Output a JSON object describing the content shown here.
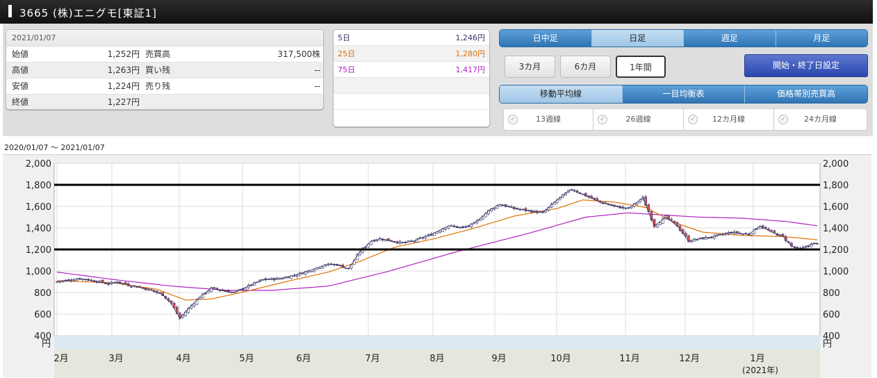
{
  "header": {
    "title": "3665 (株)エニグモ[東証1]"
  },
  "prices": {
    "date": "2021/01/07",
    "rows": [
      {
        "label": "始値",
        "value": "1,252円",
        "label2": "売買高",
        "value2": "317,500株"
      },
      {
        "label": "高値",
        "value": "1,263円",
        "label2": "買い残",
        "value2": "--"
      },
      {
        "label": "安値",
        "value": "1,224円",
        "label2": "売り残",
        "value2": "--"
      },
      {
        "label": "終値",
        "value": "1,227円",
        "label2": "",
        "value2": ""
      }
    ]
  },
  "moving_averages": [
    {
      "label": "5日",
      "value": "1,246円",
      "color": "#333366"
    },
    {
      "label": "25日",
      "value": "1,280円",
      "color": "#e07000"
    },
    {
      "label": "75日",
      "value": "1,417円",
      "color": "#b020c0"
    }
  ],
  "period_tabs": [
    "日中足",
    "日足",
    "週足",
    "月足"
  ],
  "period_active": 1,
  "range_buttons": [
    "3カ月",
    "6カ月",
    "1年間"
  ],
  "range_active": 2,
  "date_setting_button": "開始・終了日設定",
  "indicator_tabs": [
    "移動平均線",
    "一目均衡表",
    "価格帯別売買高"
  ],
  "indicator_active": 0,
  "ma_toggles": [
    "13週線",
    "26週線",
    "12カ月線",
    "24カ月線"
  ],
  "date_range": "2020/01/07 ～ 2021/01/07",
  "chart_data": {
    "type": "candlestick",
    "y_ticks": [
      "2,000",
      "1,800",
      "1,600",
      "1,400",
      "1,200",
      "1,000",
      "800",
      "600",
      "400"
    ],
    "ylim": [
      400,
      2000
    ],
    "y_unit": "円",
    "x_months": [
      "2月",
      "3月",
      "4月",
      "5月",
      "6月",
      "7月",
      "8月",
      "9月",
      "10月",
      "11月",
      "12月",
      "1月"
    ],
    "x_year_note": "(2021年)",
    "reference_lines": [
      1800,
      1200
    ],
    "price_path": [
      [
        0,
        900
      ],
      [
        8,
        930
      ],
      [
        14,
        905
      ],
      [
        18,
        880
      ],
      [
        21,
        900
      ],
      [
        25,
        870
      ],
      [
        29,
        850
      ],
      [
        33,
        820
      ],
      [
        37,
        780
      ],
      [
        40,
        700
      ],
      [
        43,
        560
      ],
      [
        46,
        650
      ],
      [
        50,
        760
      ],
      [
        54,
        840
      ],
      [
        58,
        820
      ],
      [
        62,
        800
      ],
      [
        67,
        860
      ],
      [
        72,
        920
      ],
      [
        78,
        930
      ],
      [
        83,
        960
      ],
      [
        88,
        1000
      ],
      [
        94,
        1060
      ],
      [
        98,
        1060
      ],
      [
        102,
        1020
      ],
      [
        106,
        1180
      ],
      [
        110,
        1280
      ],
      [
        113,
        1300
      ],
      [
        117,
        1280
      ],
      [
        121,
        1260
      ],
      [
        125,
        1280
      ],
      [
        131,
        1340
      ],
      [
        137,
        1420
      ],
      [
        142,
        1400
      ],
      [
        146,
        1440
      ],
      [
        151,
        1560
      ],
      [
        155,
        1620
      ],
      [
        160,
        1580
      ],
      [
        165,
        1560
      ],
      [
        170,
        1540
      ],
      [
        175,
        1660
      ],
      [
        180,
        1760
      ],
      [
        185,
        1700
      ],
      [
        190,
        1640
      ],
      [
        195,
        1600
      ],
      [
        200,
        1580
      ],
      [
        205,
        1680
      ],
      [
        209,
        1420
      ],
      [
        213,
        1500
      ],
      [
        217,
        1420
      ],
      [
        221,
        1280
      ],
      [
        225,
        1300
      ],
      [
        230,
        1320
      ],
      [
        236,
        1360
      ],
      [
        242,
        1340
      ],
      [
        246,
        1420
      ],
      [
        250,
        1360
      ],
      [
        254,
        1320
      ],
      [
        257,
        1230
      ],
      [
        260,
        1200
      ],
      [
        263,
        1240
      ],
      [
        266,
        1260
      ]
    ],
    "ma25_path": [
      [
        0,
        910
      ],
      [
        20,
        890
      ],
      [
        35,
        830
      ],
      [
        45,
        730
      ],
      [
        54,
        740
      ],
      [
        66,
        810
      ],
      [
        80,
        900
      ],
      [
        95,
        990
      ],
      [
        106,
        1090
      ],
      [
        118,
        1220
      ],
      [
        132,
        1300
      ],
      [
        145,
        1390
      ],
      [
        160,
        1510
      ],
      [
        175,
        1580
      ],
      [
        184,
        1660
      ],
      [
        195,
        1640
      ],
      [
        206,
        1590
      ],
      [
        216,
        1450
      ],
      [
        226,
        1360
      ],
      [
        240,
        1330
      ],
      [
        254,
        1320
      ],
      [
        266,
        1290
      ]
    ],
    "ma75_path": [
      [
        0,
        990
      ],
      [
        20,
        920
      ],
      [
        40,
        860
      ],
      [
        60,
        820
      ],
      [
        75,
        820
      ],
      [
        95,
        860
      ],
      [
        115,
        990
      ],
      [
        140,
        1180
      ],
      [
        165,
        1350
      ],
      [
        185,
        1500
      ],
      [
        200,
        1540
      ],
      [
        212,
        1520
      ],
      [
        225,
        1500
      ],
      [
        240,
        1490
      ],
      [
        255,
        1460
      ],
      [
        266,
        1420
      ]
    ],
    "colors": {
      "ma25": "#e07000",
      "ma75": "#b020c0",
      "candle_line": "#333366",
      "up": "#ffffff",
      "down": "#e05050"
    }
  }
}
